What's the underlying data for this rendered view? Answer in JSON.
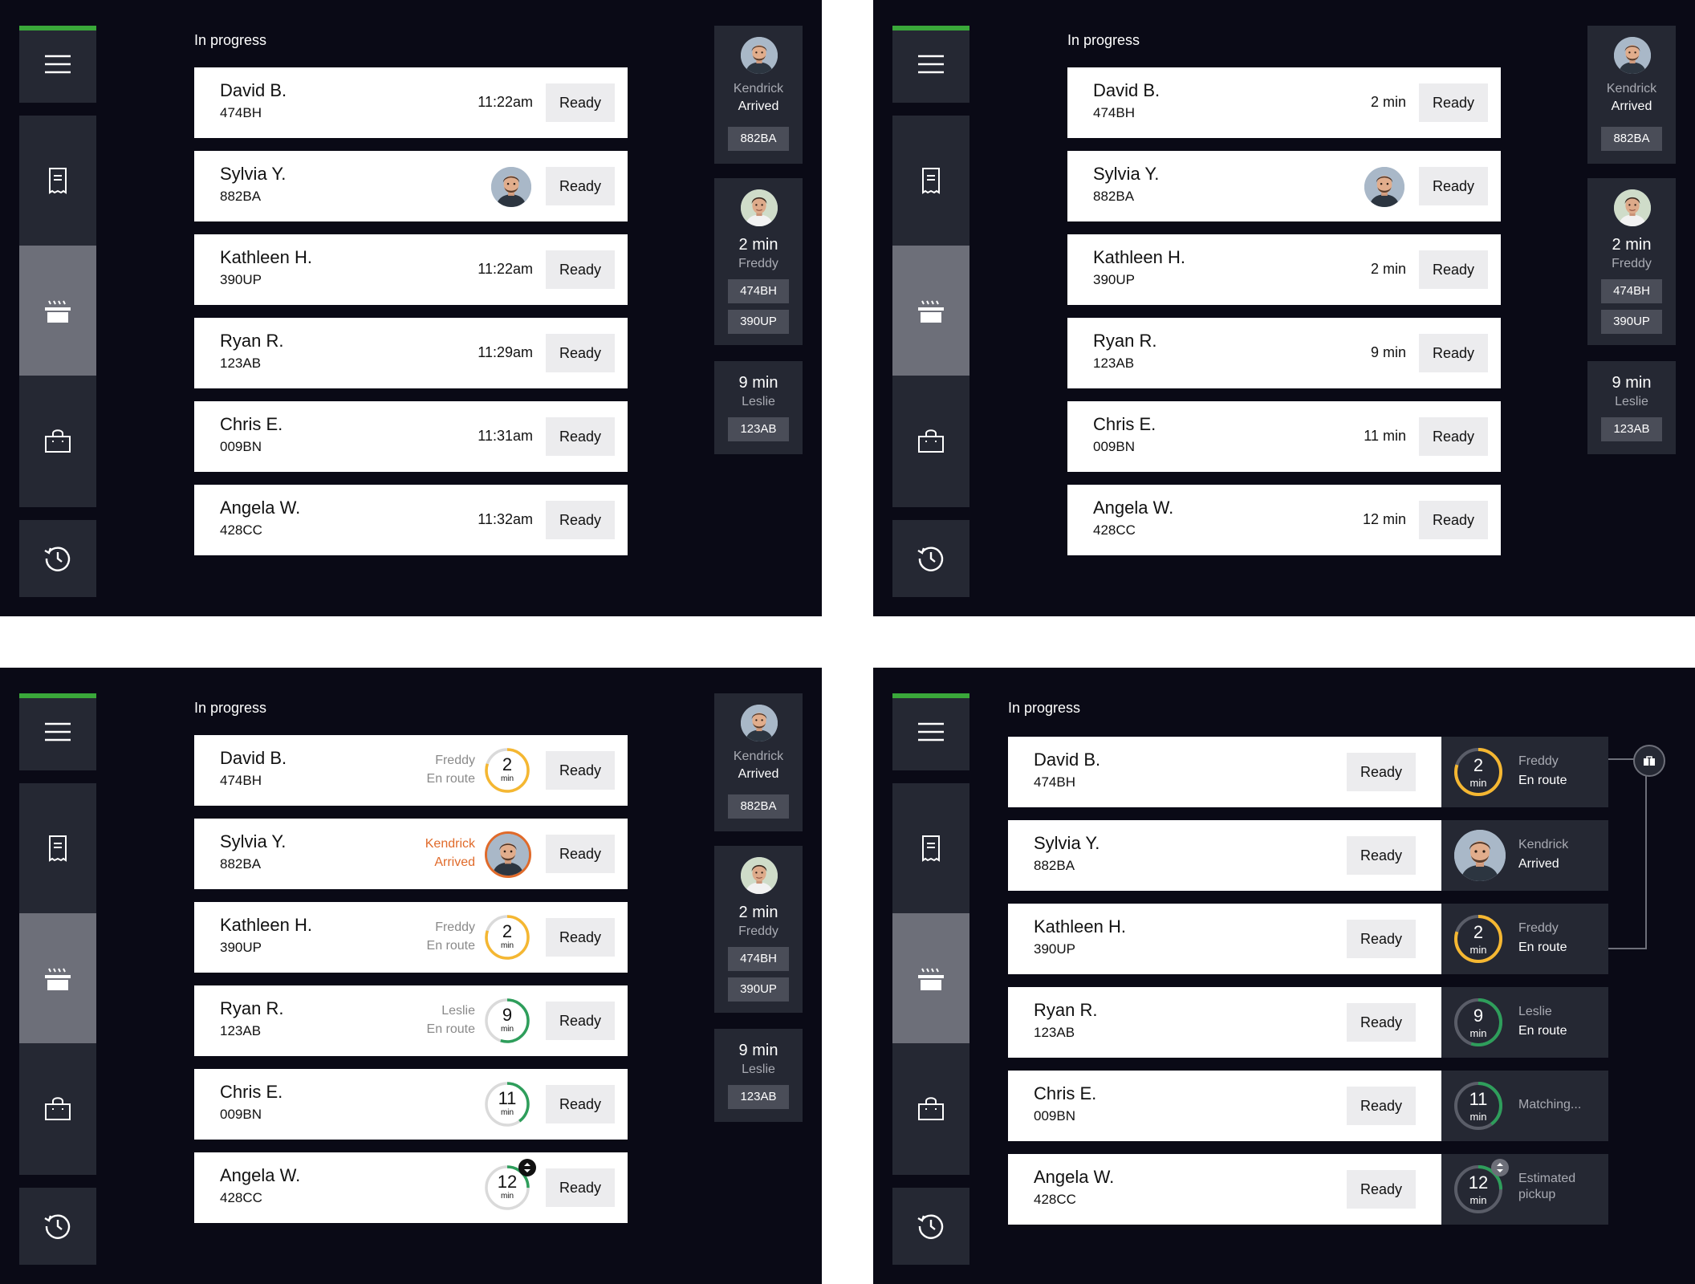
{
  "section_title": "In progress",
  "ready_label": "Ready",
  "unit_min": "min",
  "sidebar": {
    "menu_icon": "hamburger-menu-icon",
    "items": [
      {
        "icon": "receipt-icon"
      },
      {
        "icon": "cooking-pot-icon",
        "active": true
      },
      {
        "icon": "shopping-bag-icon"
      }
    ],
    "history_icon": "history-icon"
  },
  "panel1": {
    "orders": [
      {
        "name": "David B.",
        "code": "474BH",
        "time": "11:22am"
      },
      {
        "name": "Sylvia Y.",
        "code": "882BA",
        "avatar": "courier-avatar"
      },
      {
        "name": "Kathleen H.",
        "code": "390UP",
        "time": "11:22am"
      },
      {
        "name": "Ryan R.",
        "code": "123AB",
        "time": "11:29am"
      },
      {
        "name": "Chris E.",
        "code": "009BN",
        "time": "11:31am"
      },
      {
        "name": "Angela W.",
        "code": "428CC",
        "time": "11:32am"
      }
    ]
  },
  "panel2": {
    "orders": [
      {
        "name": "David B.",
        "code": "474BH",
        "time": "2 min"
      },
      {
        "name": "Sylvia Y.",
        "code": "882BA",
        "avatar": "courier-avatar"
      },
      {
        "name": "Kathleen H.",
        "code": "390UP",
        "time": "2 min"
      },
      {
        "name": "Ryan R.",
        "code": "123AB",
        "time": "9 min"
      },
      {
        "name": "Chris E.",
        "code": "009BN",
        "time": "11 min"
      },
      {
        "name": "Angela W.",
        "code": "428CC",
        "time": "12 min"
      }
    ]
  },
  "panel3": {
    "orders": [
      {
        "name": "David B.",
        "code": "474BH",
        "courier": "Freddy",
        "status": "En route",
        "minutes": "2",
        "progress": 0.8,
        "color": "#f5b731"
      },
      {
        "name": "Sylvia Y.",
        "code": "882BA",
        "courier": "Kendrick",
        "status": "Arrived",
        "alert": true
      },
      {
        "name": "Kathleen H.",
        "code": "390UP",
        "courier": "Freddy",
        "status": "En route",
        "minutes": "2",
        "progress": 0.8,
        "color": "#f5b731"
      },
      {
        "name": "Ryan R.",
        "code": "123AB",
        "courier": "Leslie",
        "status": "En route",
        "minutes": "9",
        "progress": 0.55,
        "color": "#2e9e5b"
      },
      {
        "name": "Chris E.",
        "code": "009BN",
        "minutes": "11",
        "progress": 0.4,
        "color": "#2e9e5b"
      },
      {
        "name": "Angela W.",
        "code": "428CC",
        "minutes": "12",
        "progress": 0.25,
        "color": "#2e9e5b",
        "adjust": true
      }
    ]
  },
  "panel4": {
    "orders": [
      {
        "name": "David B.",
        "code": "474BH",
        "minutes": "2",
        "progress": 0.8,
        "color": "#f5b731",
        "line1": "Freddy",
        "line2": "En route"
      },
      {
        "name": "Sylvia Y.",
        "code": "882BA",
        "avatar": true,
        "line1": "Kendrick",
        "line2": "Arrived"
      },
      {
        "name": "Kathleen H.",
        "code": "390UP",
        "minutes": "2",
        "progress": 0.8,
        "color": "#f5b731",
        "line1": "Freddy",
        "line2": "En route"
      },
      {
        "name": "Ryan R.",
        "code": "123AB",
        "minutes": "9",
        "progress": 0.55,
        "color": "#2e9e5b",
        "line1": "Leslie",
        "line2": "En route"
      },
      {
        "name": "Chris E.",
        "code": "009BN",
        "minutes": "11",
        "progress": 0.4,
        "color": "#2e9e5b",
        "single": "Matching..."
      },
      {
        "name": "Angela W.",
        "code": "428CC",
        "minutes": "12",
        "progress": 0.25,
        "color": "#2e9e5b",
        "line1": "Estimated",
        "line2": "pickup",
        "adjust": true
      }
    ],
    "group_icon": "bag-icon"
  },
  "couriers": [
    {
      "name": "Kendrick",
      "status": "Arrived",
      "codes": [
        "882BA"
      ]
    },
    {
      "eta": "2 min",
      "name": "Freddy",
      "codes": [
        "474BH",
        "390UP"
      ]
    },
    {
      "eta": "9 min",
      "name": "Leslie",
      "codes": [
        "123AB"
      ]
    }
  ]
}
